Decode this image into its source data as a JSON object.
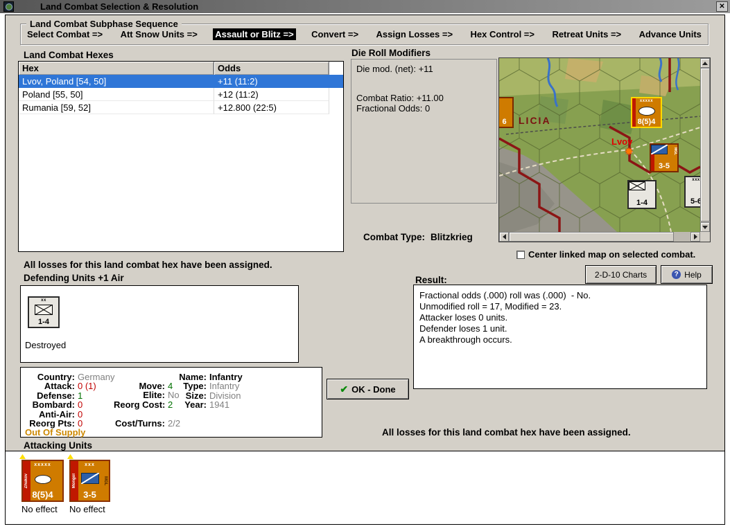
{
  "colors": {
    "dialog_bg": "#d4d0c8",
    "selection_blue": "#2f76d7",
    "counter_orange": "#cf7b00",
    "value_red": "#c00000",
    "value_green": "#007000",
    "supply_orange": "#cc8800",
    "map_city_red": "#e00000",
    "highlight_yellow": "#ffd800"
  },
  "window": {
    "title": "Land Combat Selection & Resolution",
    "close_glyph": "✕"
  },
  "sequence": {
    "title": "Land Combat Subphase Sequence",
    "steps": [
      {
        "label": "Select Combat =>"
      },
      {
        "label": "Att Snow Units =>"
      },
      {
        "label": "Assault or Blitz =>"
      },
      {
        "label": "Convert =>"
      },
      {
        "label": "Assign Losses =>"
      },
      {
        "label": "Hex Control =>"
      },
      {
        "label": "Retreat Units =>"
      },
      {
        "label": "Advance Units"
      }
    ]
  },
  "hex_list": {
    "title": "Land Combat Hexes",
    "columns": {
      "hex": "Hex",
      "odds": "Odds"
    },
    "rows": [
      {
        "hex": "Lvov, Poland [54, 50]",
        "odds": "+11 (11:2)"
      },
      {
        "hex": "Poland [55, 50]",
        "odds": "+12 (11:2)"
      },
      {
        "hex": "Rumania [59, 52]",
        "odds": "+12.800 (22:5)"
      }
    ]
  },
  "modifiers": {
    "title": "Die Roll Modifiers",
    "die_mod": "Die mod. (net): +11",
    "combat_ratio": "Combat Ratio: +11.00",
    "fractional_odds": "Fractional Odds: 0"
  },
  "combat_type": {
    "label": "Combat Type:",
    "value": "Blitzkrieg"
  },
  "map": {
    "region_label": "LICIA",
    "city_label": "Lvov",
    "explosion_glyph": "✸",
    "checkbox_label": "Center linked map on selected combat.",
    "units": {
      "hq": {
        "size": "xxxxx",
        "strength": "8(5)4"
      },
      "cavalry": {
        "size": "xxx",
        "strength": "3-5",
        "side_label": "MGL"
      },
      "infantry": {
        "size": "xx",
        "strength": "1-4"
      },
      "edge_left": {
        "strength": "6"
      },
      "edge_right": {
        "size": "xxx",
        "strength": "5-6"
      }
    }
  },
  "buttons": {
    "charts": "2-D-10 Charts",
    "help": "Help",
    "help_icon_glyph": "?",
    "ok_done": "OK - Done",
    "ok_icon_glyph": "✔"
  },
  "messages": {
    "losses_left": "All losses for this land combat hex have been assigned.",
    "losses_right": "All losses for this land combat hex have been assigned.",
    "result_title": "Result:"
  },
  "result_lines": [
    "Fractional odds (.000) roll was (.000)  - No.",
    "Unmodified roll = 17, Modified = 23.",
    "Attacker loses 0 units.",
    "Defender loses 1 unit.",
    "A breakthrough occurs."
  ],
  "defending": {
    "title": "Defending Units +1 Air",
    "unit": {
      "size": "xx",
      "strength": "1-4",
      "status": "Destroyed"
    }
  },
  "details": {
    "country_label": "Country:",
    "country": "Germany",
    "attack_label": "Attack:",
    "attack": "0 (1)",
    "defense_label": "Defense:",
    "defense": "1",
    "bombard_label": "Bombard:",
    "bombard": "0",
    "antiair_label": "Anti-Air:",
    "antiair": "0",
    "reorgpts_label": "Reorg Pts:",
    "reorgpts": "0",
    "move_label": "Move:",
    "move": "4",
    "elite_label": "Elite:",
    "elite": "No",
    "reorgcost_label": "Reorg Cost:",
    "reorgcost": "2",
    "costturns_label": "Cost/Turns:",
    "costturns": "2/2",
    "name_label": "Name:",
    "name": "Infantry",
    "type_label": "Type:",
    "type": "Infantry",
    "size_label": "Size:",
    "size": "Division",
    "year_label": "Year:",
    "year": "1941",
    "supply_status": "Out Of Supply"
  },
  "attacking": {
    "title": "Attacking Units",
    "units": [
      {
        "size": "xxxxx",
        "strength": "8(5)4",
        "left_label": "Zhukov",
        "status": "No effect"
      },
      {
        "size": "xxx",
        "strength": "3-5",
        "left_label": "Mongol",
        "right_label": "MGL",
        "status": "No effect"
      }
    ]
  }
}
